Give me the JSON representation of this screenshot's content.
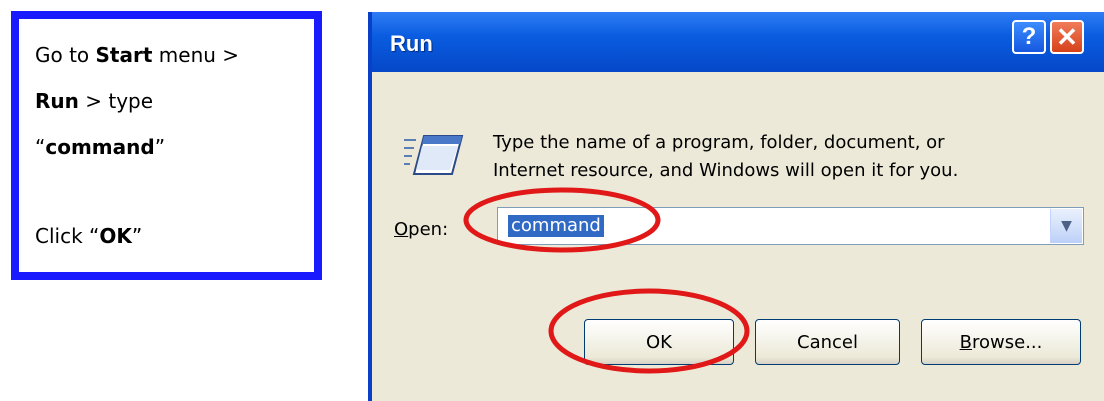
{
  "instructions": {
    "l1_pre": "Go to ",
    "l1_bold": "Start",
    "l1_post": " menu >",
    "l2_bold": "Run",
    "l2_post": " > type",
    "l3_open": "“",
    "l3_bold": "command",
    "l3_close": "”",
    "l4_pre": "Click “",
    "l4_bold": "OK",
    "l4_post": "”"
  },
  "dialog": {
    "title": "Run",
    "help_glyph": "?",
    "close_glyph": "✕",
    "description_line1": "Type the name of a program, folder, document, or",
    "description_line2": "Internet resource, and Windows will open it for you.",
    "open_label_accel": "O",
    "open_label_rest": "pen:",
    "open_value": "command",
    "dropdown_glyph": "▼",
    "ok_label": "OK",
    "cancel_label": "Cancel",
    "browse_accel": "B",
    "browse_rest": "rowse..."
  },
  "icons": {
    "run": "run-program-icon",
    "help": "help-icon",
    "close": "close-icon",
    "dropdown": "chevron-down-icon"
  },
  "colors": {
    "instruction_border": "#1a1aff",
    "highlight_circle": "#e01818",
    "titlebar": "#0a5ce0",
    "selection": "#316ac5"
  }
}
